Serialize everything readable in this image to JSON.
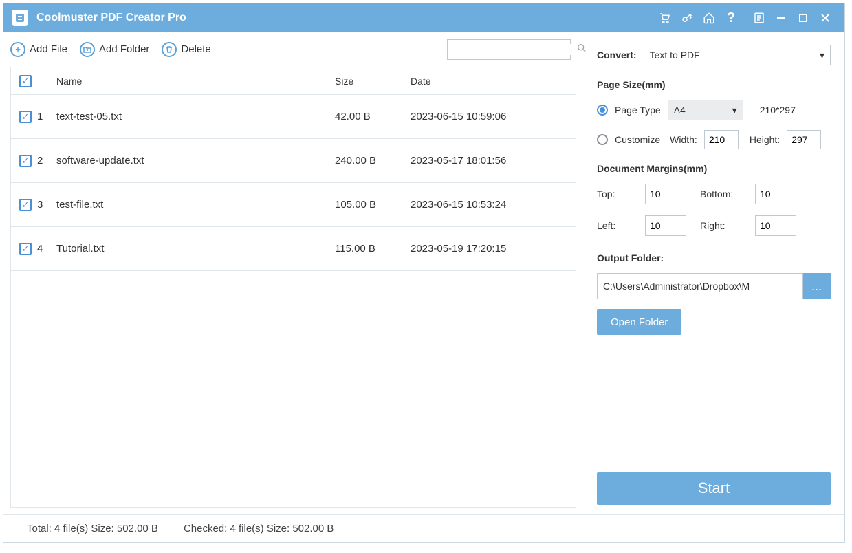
{
  "titlebar": {
    "title": "Coolmuster PDF Creator Pro"
  },
  "toolbar": {
    "add_file": "Add File",
    "add_folder": "Add Folder",
    "delete": "Delete",
    "search_placeholder": ""
  },
  "table": {
    "headers": {
      "name": "Name",
      "size": "Size",
      "date": "Date"
    },
    "rows": [
      {
        "index": "1",
        "name": "text-test-05.txt",
        "size": "42.00 B",
        "date": "2023-06-15 10:59:06",
        "checked": true
      },
      {
        "index": "2",
        "name": "software-update.txt",
        "size": "240.00 B",
        "date": "2023-05-17 18:01:56",
        "checked": true
      },
      {
        "index": "3",
        "name": "test-file.txt",
        "size": "105.00 B",
        "date": "2023-06-15 10:53:24",
        "checked": true
      },
      {
        "index": "4",
        "name": "Tutorial.txt",
        "size": "115.00 B",
        "date": "2023-05-19 17:20:15",
        "checked": true
      }
    ]
  },
  "convert": {
    "label": "Convert:",
    "value": "Text to PDF"
  },
  "page_size": {
    "title": "Page Size(mm)",
    "page_type_label": "Page Type",
    "page_type_value": "A4",
    "dims_text": "210*297",
    "customize_label": "Customize",
    "width_label": "Width:",
    "width_value": "210",
    "height_label": "Height:",
    "height_value": "297"
  },
  "margins": {
    "title": "Document Margins(mm)",
    "top_label": "Top:",
    "top_value": "10",
    "bottom_label": "Bottom:",
    "bottom_value": "10",
    "left_label": "Left:",
    "left_value": "10",
    "right_label": "Right:",
    "right_value": "10"
  },
  "output": {
    "title": "Output Folder:",
    "path": "C:\\Users\\Administrator\\Dropbox\\M",
    "browse": "...",
    "open_folder": "Open Folder"
  },
  "start": {
    "label": "Start"
  },
  "status": {
    "total": "Total: 4 file(s) Size: 502.00 B",
    "checked": "Checked: 4 file(s) Size: 502.00 B"
  }
}
